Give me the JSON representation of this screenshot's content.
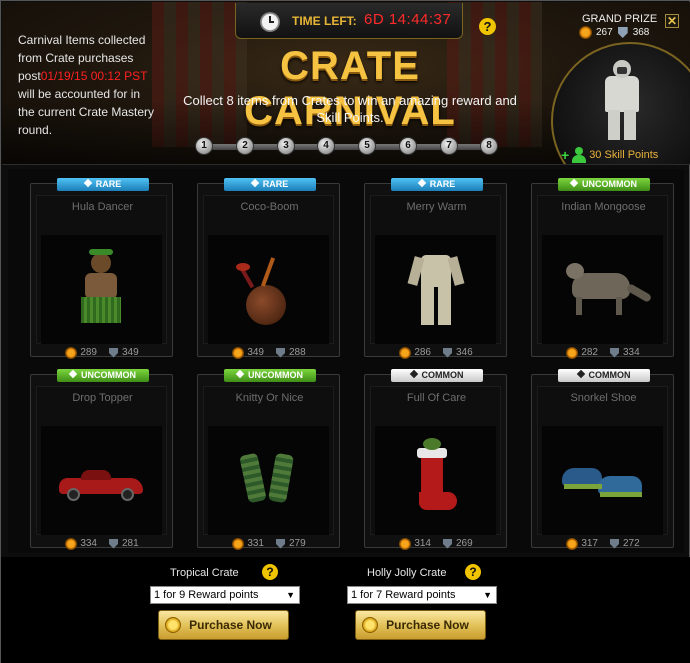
{
  "header": {
    "timer": {
      "label": "TIME LEFT:",
      "value": "6D 14:44:37"
    },
    "info": {
      "part1": "Carnival Items collected from Crate purchases post",
      "date": "01/19/15 00:12 PST",
      "part2": " will be accounted for in the current Crate Mastery round."
    },
    "title": "CRATE CARNIVAL",
    "subtitle": "Collect 8 items from Crates to win an amazing reward and Skill Points.",
    "progress_steps": [
      "1",
      "2",
      "3",
      "4",
      "5",
      "6",
      "7",
      "8"
    ],
    "grand_prize": {
      "label": "GRAND PRIZE",
      "attack": "267",
      "defense": "368",
      "skill_points": "30 Skill Points"
    },
    "close_label": "✕"
  },
  "items": [
    {
      "rarity": "RARE",
      "name": "Hula Dancer",
      "attack": "289",
      "defense": "349"
    },
    {
      "rarity": "RARE",
      "name": "Coco-Boom",
      "attack": "349",
      "defense": "288"
    },
    {
      "rarity": "RARE",
      "name": "Merry Warm",
      "attack": "286",
      "defense": "346"
    },
    {
      "rarity": "UNCOMMON",
      "name": "Indian Mongoose",
      "attack": "282",
      "defense": "334"
    },
    {
      "rarity": "UNCOMMON",
      "name": "Drop Topper",
      "attack": "334",
      "defense": "281"
    },
    {
      "rarity": "UNCOMMON",
      "name": "Knitty Or Nice",
      "attack": "331",
      "defense": "279"
    },
    {
      "rarity": "COMMON",
      "name": "Full Of Care",
      "attack": "314",
      "defense": "269"
    },
    {
      "rarity": "COMMON",
      "name": "Snorkel Shoe",
      "attack": "317",
      "defense": "272"
    }
  ],
  "crates": [
    {
      "title": "Tropical Crate",
      "selected": "1 for 9 Reward points",
      "button": "Purchase Now"
    },
    {
      "title": "Holly Jolly Crate",
      "selected": "1 for 7 Reward points",
      "button": "Purchase Now"
    }
  ],
  "colors": {
    "rare": "#2a9ad6",
    "uncommon": "#54ab22",
    "common": "#e6e6e6",
    "timer": "#ff2a2a",
    "title": "#f6c241"
  }
}
